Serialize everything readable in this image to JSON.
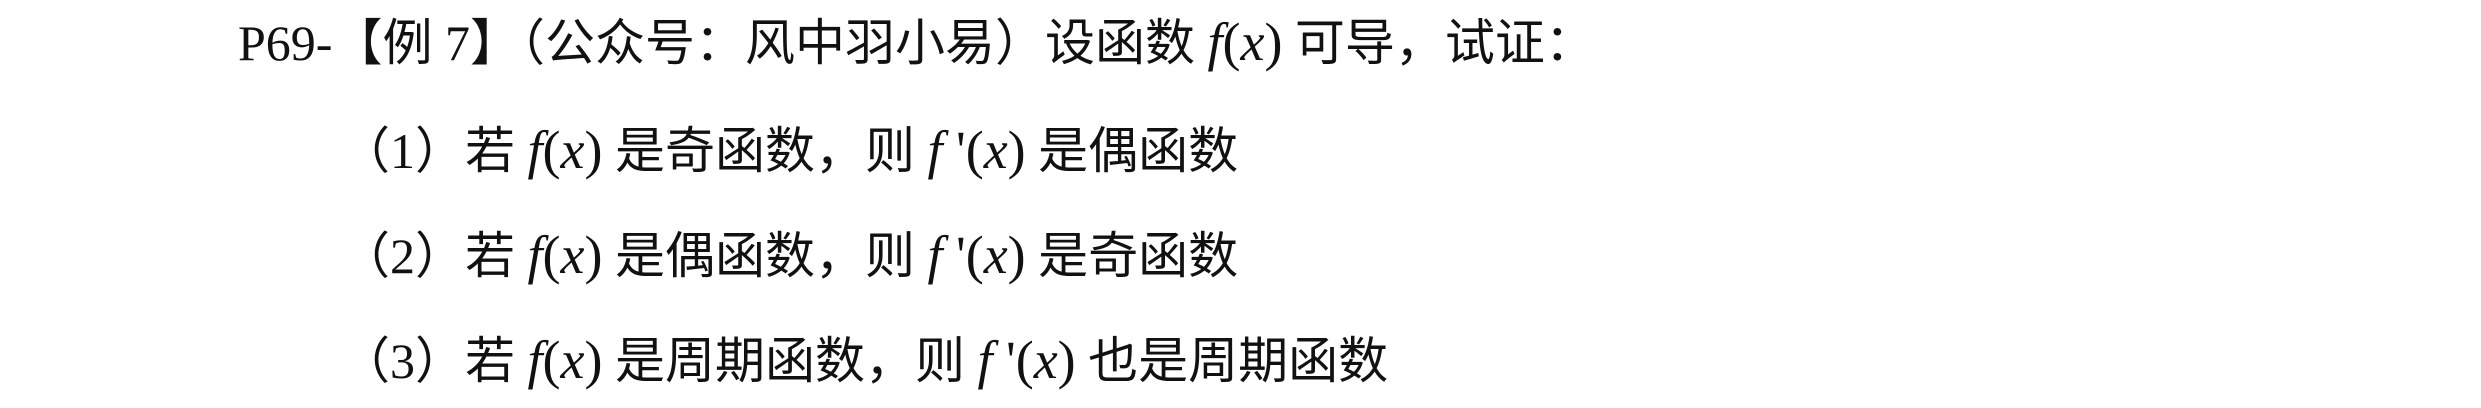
{
  "header": {
    "prefix": "P69-【例 7】（公众号：风中羽小易）设函数",
    "fx": "f(x)",
    "suffix": "可导，试证："
  },
  "items": [
    {
      "num": "（1）若",
      "fx": "f(x)",
      "mid": "是奇函数，则",
      "dfx": "f '(x)",
      "end": "是偶函数"
    },
    {
      "num": "（2）若",
      "fx": "f(x)",
      "mid": "是偶函数，则",
      "dfx": "f '(x)",
      "end": "是奇函数"
    },
    {
      "num": "（3）若",
      "fx": "f(x)",
      "mid": "是周期函数，则",
      "dfx": "f '(x)",
      "end": "也是周期函数"
    }
  ]
}
